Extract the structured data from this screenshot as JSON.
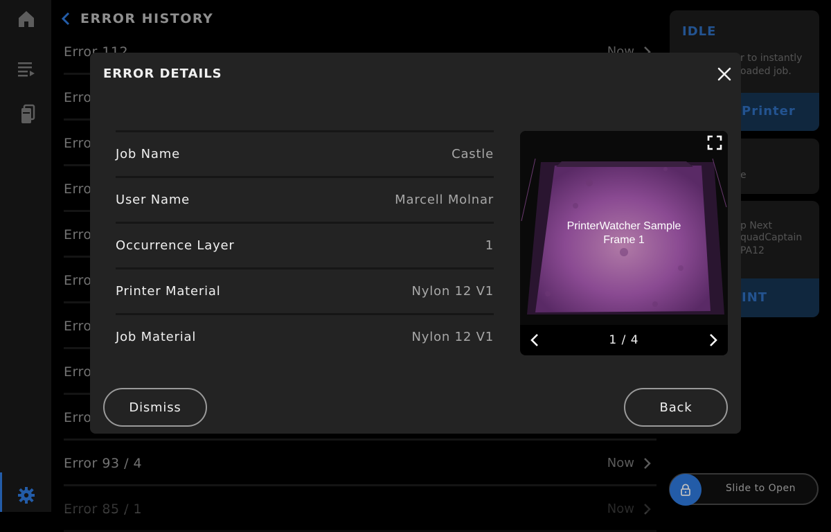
{
  "sidebar": {
    "icons": [
      "home-icon",
      "queue-icon",
      "materials-icon",
      "settings-icon"
    ]
  },
  "history": {
    "title": "ERROR HISTORY",
    "rows": [
      {
        "title": "Error 112",
        "time": "Now"
      },
      {
        "title": "Error",
        "time": ""
      },
      {
        "title": "Error",
        "time": ""
      },
      {
        "title": "Error",
        "time": ""
      },
      {
        "title": "Error",
        "time": ""
      },
      {
        "title": "Error",
        "time": ""
      },
      {
        "title": "Error",
        "time": ""
      },
      {
        "title": "Error",
        "time": ""
      },
      {
        "title": "Error",
        "time": ""
      },
      {
        "title": "Error 93 / 4",
        "time": "Now"
      },
      {
        "title": "Error 85 / 1",
        "time": "Now"
      }
    ]
  },
  "right_panel": {
    "status": "IDLE",
    "status_text_1": "r to instantly",
    "status_text_2": "oaded job.",
    "printer_button": "Printer",
    "card2_text": "e",
    "card3_line1": "p Next",
    "card3_line2": "quadCaptain",
    "card3_line3": "PA12",
    "print_button": "INT",
    "slide_label": "Slide to Open"
  },
  "modal": {
    "title": "ERROR DETAILS",
    "details": [
      {
        "label": "Job Name",
        "value": "Castle"
      },
      {
        "label": "User Name",
        "value": "Marcell Molnar"
      },
      {
        "label": "Occurrence Layer",
        "value": "1"
      },
      {
        "label": "Printer Material",
        "value": "Nylon 12 V1"
      },
      {
        "label": "Job Material",
        "value": "Nylon 12 V1"
      }
    ],
    "viewer": {
      "frame_line1": "PrinterWatcher Sample",
      "frame_line2": "Frame 1",
      "page": "1 / 4"
    },
    "dismiss_label": "Dismiss",
    "back_label": "Back"
  },
  "colors": {
    "accent": "#2f7be0",
    "modal_bg": "#232323",
    "frame_purple": "#7a3f86"
  }
}
